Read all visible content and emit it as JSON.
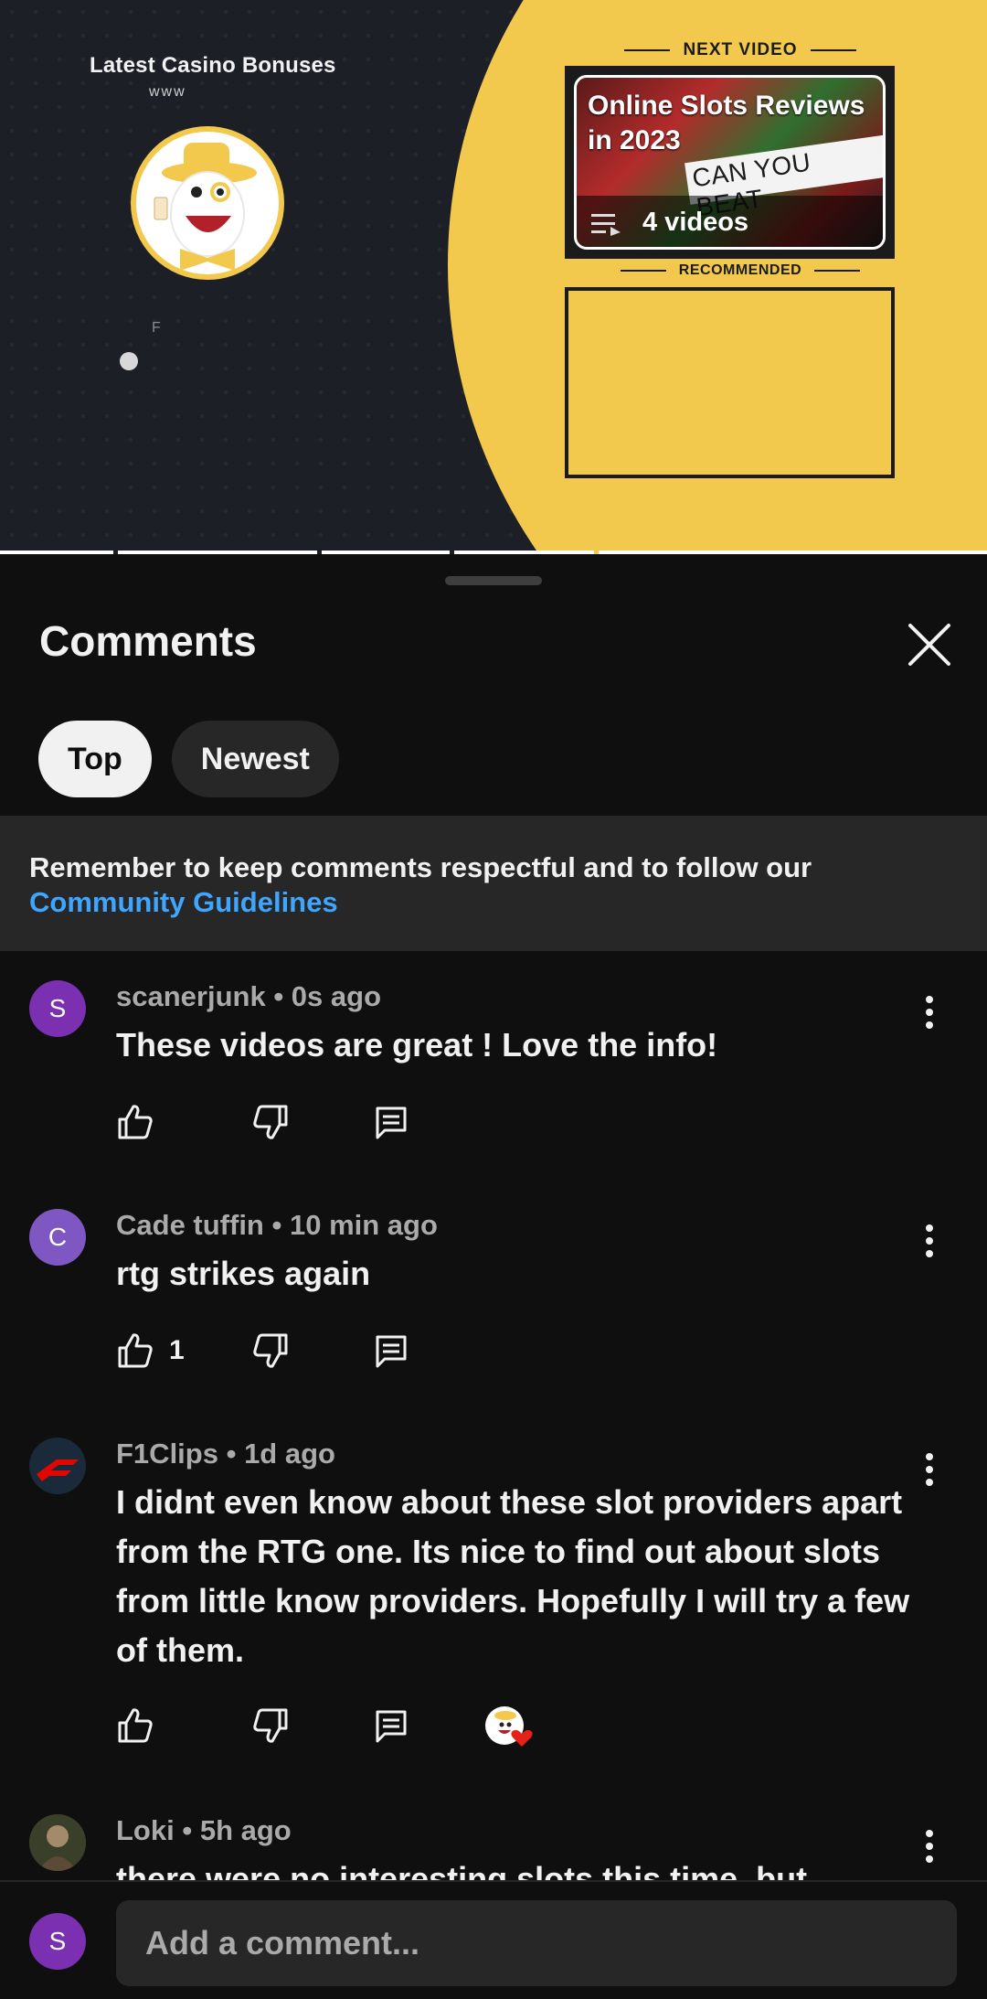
{
  "video": {
    "brand_title": "Latest Casino Bonuses",
    "brand_sub": "www",
    "faint_text": "F",
    "next_label": "NEXT VIDEO",
    "next_card": {
      "title": "Online Slots Reviews in 2023",
      "banner": "CAN YOU BEAT",
      "videos": "4 videos"
    },
    "recommended_label": "RECOMMENDED",
    "colors": {
      "accent_yellow": "#f2c94c",
      "background": "#1d1f26"
    }
  },
  "comments_panel": {
    "title": "Comments",
    "tabs": [
      {
        "label": "Top",
        "active": true
      },
      {
        "label": "Newest",
        "active": false
      }
    ],
    "notice": {
      "text": "Remember to keep comments respectful and to follow our ",
      "link": "Community Guidelines"
    },
    "comments": [
      {
        "avatar_letter": "S",
        "avatar_color": "#7b2fb1",
        "author": "scanerjunk",
        "time": "0s ago",
        "text": "These videos are great ! Love the info!",
        "likes": ""
      },
      {
        "avatar_letter": "C",
        "avatar_color": "#7e57c2",
        "author": "Cade tuffin",
        "time": "10 min ago",
        "text": "rtg strikes again",
        "likes": "1"
      },
      {
        "avatar_letter": "",
        "avatar_color": "#1b2a3a",
        "author": "F1Clips",
        "time": "1d ago",
        "text": "I didnt even know about these slot providers apart from the RTG one. Its nice to find out about slots from little know providers. Hopefully I will try a few of them.",
        "likes": "",
        "creator_heart": true
      },
      {
        "avatar_letter": "",
        "avatar_color": "#3a3f2a",
        "author": "Loki",
        "time": "5h ago",
        "text": "there were no interesting slots this time, but",
        "likes": ""
      }
    ],
    "separator": " • "
  },
  "bottom_bar": {
    "avatar_letter": "S",
    "placeholder": "Add a comment..."
  }
}
